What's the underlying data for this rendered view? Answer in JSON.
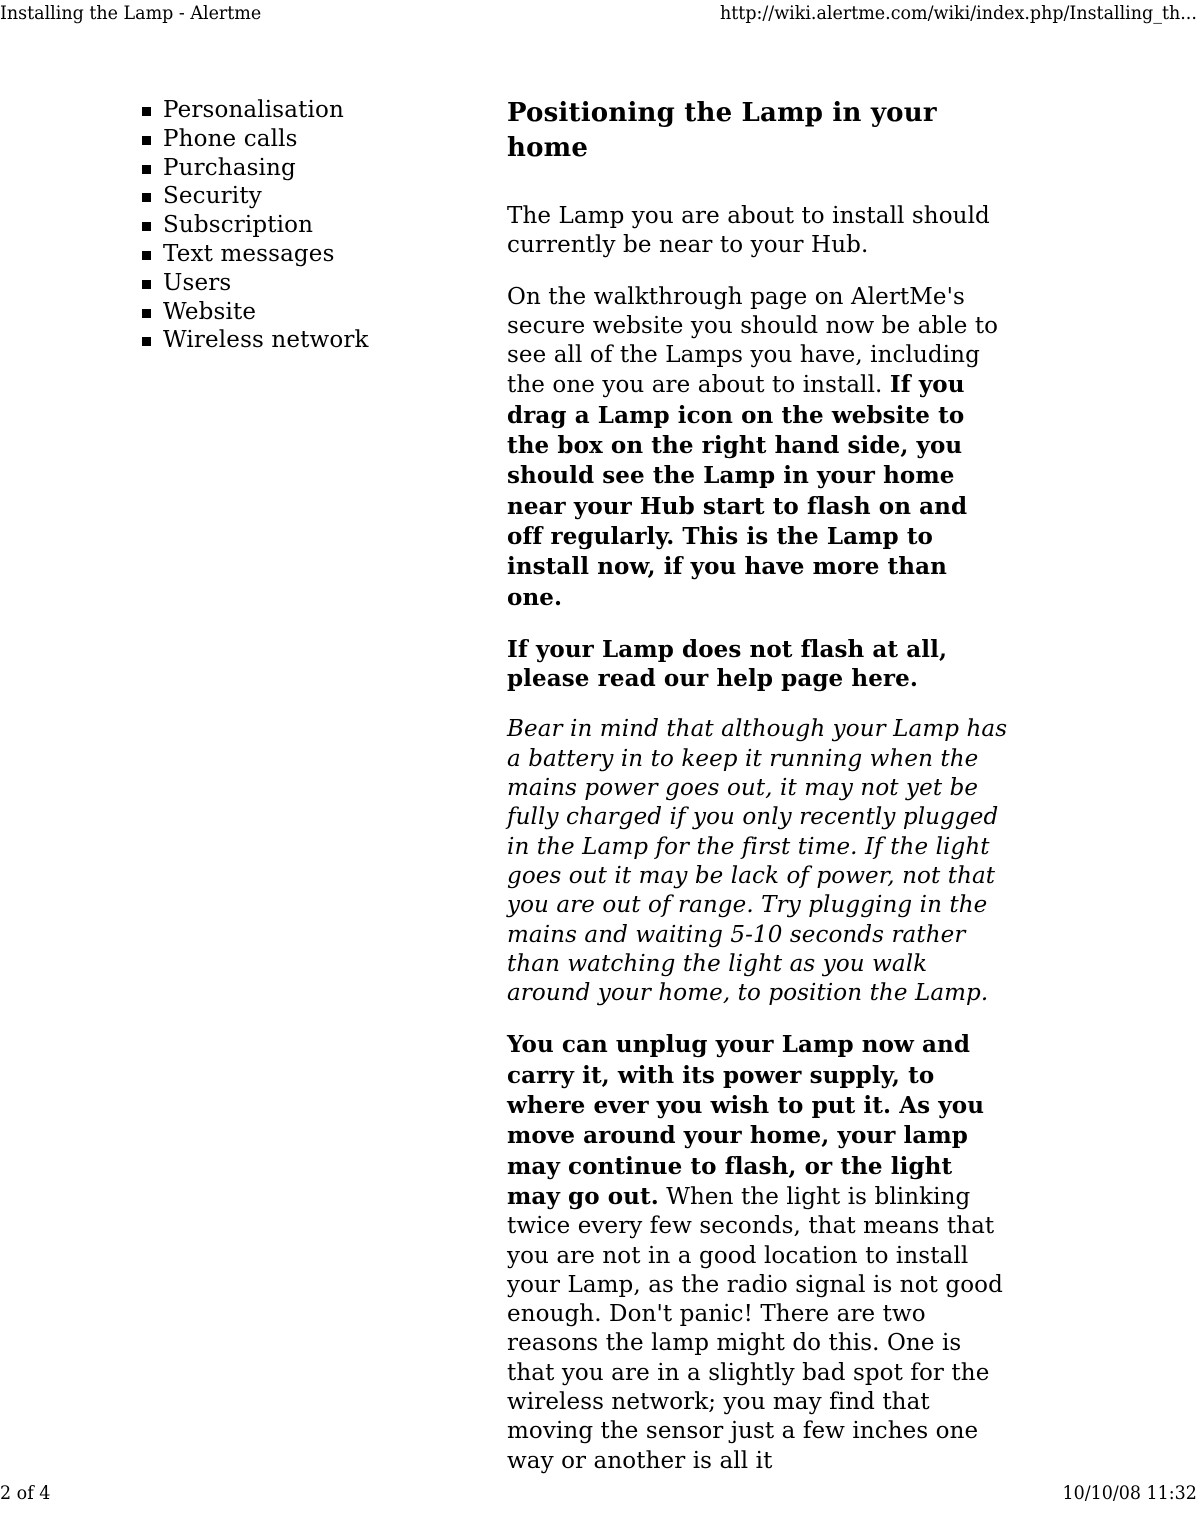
{
  "header": {
    "title": "Installing the Lamp - Alertme",
    "url": "http://wiki.alertme.com/wiki/index.php/Installing_th..."
  },
  "footer": {
    "page_indicator": "2 of 4",
    "timestamp": "10/10/08 11:32"
  },
  "sidebar": {
    "items": [
      {
        "label": "Personalisation"
      },
      {
        "label": "Phone calls"
      },
      {
        "label": "Purchasing"
      },
      {
        "label": "Security"
      },
      {
        "label": "Subscription"
      },
      {
        "label": "Text messages"
      },
      {
        "label": "Users"
      },
      {
        "label": "Website"
      },
      {
        "label": "Wireless network"
      }
    ],
    "bullet_glyph": "square-bullet-icon"
  },
  "main": {
    "heading": "Positioning the Lamp in your home",
    "paragraph_1": "The Lamp you are about to install should currently be near to your Hub.",
    "paragraph_2_plain": "On the walkthrough page on AlertMe's secure website you should now be able to see all of the Lamps you have, including the one you are about to install. ",
    "paragraph_2_bold": "If you drag a Lamp icon on the website to the box on the right hand side, you should see the Lamp in your home near your Hub start to flash on and off regularly. This is the Lamp to install now, if you have more than one.",
    "paragraph_3_bold": "If your Lamp does not flash at all, please read our help page here.",
    "paragraph_4_italic": "Bear in mind that although your Lamp has a battery in to keep it running when the mains power goes out, it may not yet be fully charged if you only recently plugged in the Lamp for the first time. If the light goes out it may be lack of power, not that you are out of range. Try plugging in the mains and waiting 5-10 seconds rather than watching the light as you walk around your home, to position the Lamp.",
    "paragraph_5_bold": "You can unplug your Lamp now and carry it, with its power supply, to where ever you wish to put it. As you move around your home, your lamp may continue to flash, or the light may go out.",
    "paragraph_5_plain": " When the light is blinking twice every few seconds, that means that you are not in a good location to install your Lamp, as the radio signal is not good enough. Don't panic! There are two reasons the lamp might do this. One is that you are in a slightly bad spot for the wireless network; you may find that moving the sensor just a few inches one way or another is all it"
  }
}
